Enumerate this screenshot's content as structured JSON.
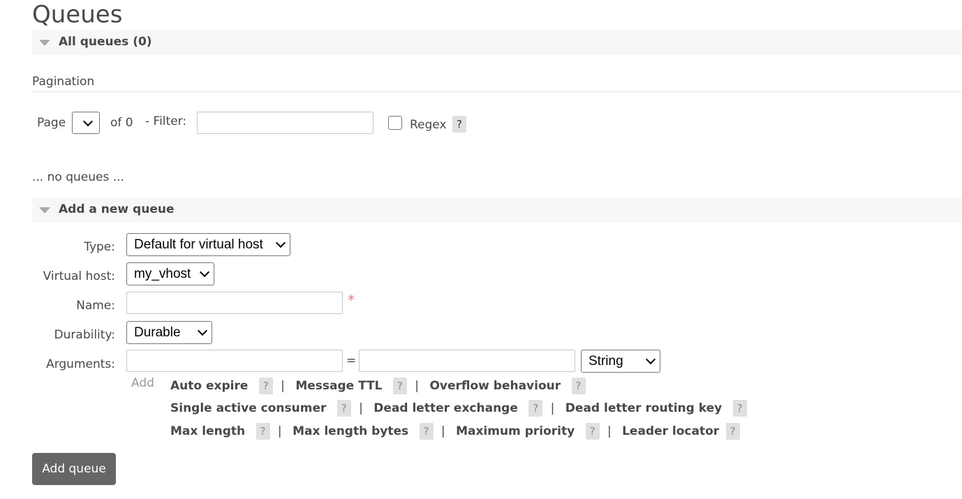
{
  "page": {
    "title": "Queues"
  },
  "all_queues": {
    "title": "All queues (0)"
  },
  "pagination": {
    "heading": "Pagination",
    "page_label": "Page",
    "of_label": "of 0",
    "filter_label": "- Filter:",
    "filter_value": "",
    "regex_label": "Regex",
    "help": "?"
  },
  "empty_message": "... no queues ...",
  "add_queue": {
    "title": "Add a new queue",
    "fields": {
      "type_label": "Type:",
      "type_value": "Default for virtual host",
      "vhost_label": "Virtual host:",
      "vhost_value": "my_vhost",
      "name_label": "Name:",
      "name_value": "",
      "required_mark": "*",
      "durability_label": "Durability:",
      "durability_value": "Durable",
      "arguments_label": "Arguments:",
      "equals": "=",
      "arg_type_value": "String",
      "add_label": "Add"
    },
    "arg_shortcuts": {
      "row1": [
        "Auto expire",
        "Message TTL",
        "Overflow behaviour"
      ],
      "row2": [
        "Single active consumer",
        "Dead letter exchange",
        "Dead letter routing key"
      ],
      "row3": [
        "Max length",
        "Max length bytes",
        "Maximum priority",
        "Leader locator"
      ],
      "help": "?",
      "separator": "|"
    },
    "submit_label": "Add queue"
  }
}
